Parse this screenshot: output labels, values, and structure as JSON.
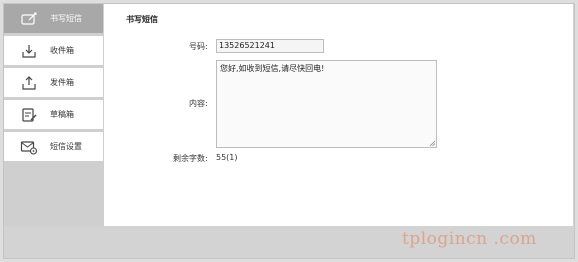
{
  "sidebar": {
    "items": [
      {
        "label": "书写短信",
        "icon": "compose-icon",
        "active": true
      },
      {
        "label": "收件箱",
        "icon": "inbox-icon",
        "active": false
      },
      {
        "label": "发件箱",
        "icon": "outbox-icon",
        "active": false
      },
      {
        "label": "草稿箱",
        "icon": "drafts-icon",
        "active": false
      },
      {
        "label": "短信设置",
        "icon": "sms-settings-icon",
        "active": false
      }
    ]
  },
  "form": {
    "title": "书写短信",
    "number_label": "号码:",
    "number_value": "13526521241",
    "content_label": "内容:",
    "content_value": "您好,如收到短信,请尽快回电!",
    "remaining_label": "剩余字数:",
    "remaining_value": "55(1)"
  },
  "watermark": "tplogincn .com",
  "colors": {
    "active_nav_bg": "#a8a8a8",
    "frame_bg": "#d3d3d3",
    "watermark": "#d9a58c"
  }
}
